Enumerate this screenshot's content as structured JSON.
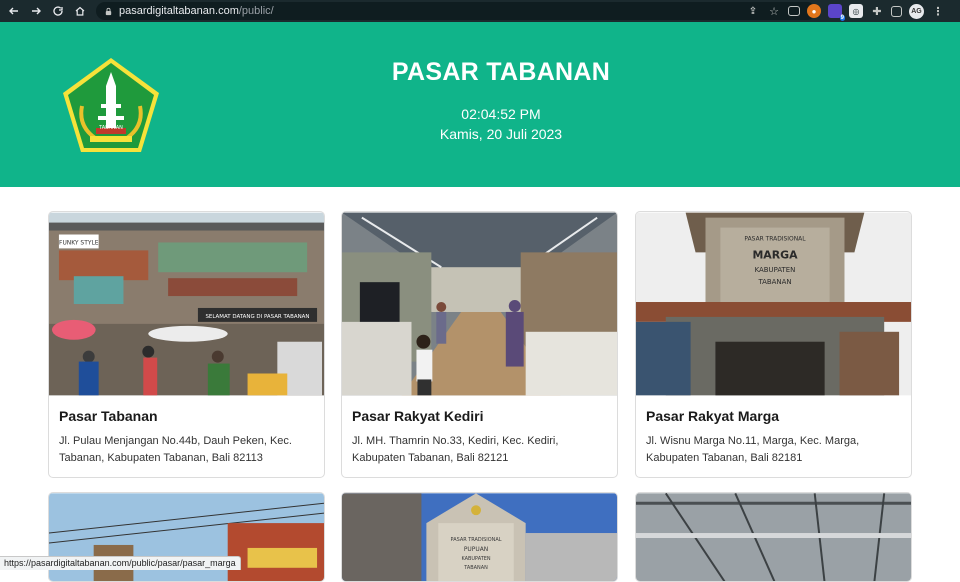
{
  "browser": {
    "url_host": "pasardigitaltabanan.com",
    "url_path": "/public/",
    "extension_badge": "9",
    "profile_initials": "AG"
  },
  "header": {
    "title": "PASAR TABANAN",
    "time": "02:04:52 PM",
    "date": "Kamis, 20 Juli 2023",
    "logo_caption": "TABANAN"
  },
  "markets": [
    {
      "name": "Pasar Tabanan",
      "address": "Jl. Pulau Menjangan No.44b, Dauh Peken, Kec. Tabanan, Kabupaten Tabanan, Bali 82113",
      "photo_sign": "SELAMAT DATANG DI PASAR TABANAN",
      "photo_sign2": "FUNKY STYLE"
    },
    {
      "name": "Pasar Rakyat Kediri",
      "address": "Jl. MH. Thamrin No.33, Kediri, Kec. Kediri, Kabupaten Tabanan, Bali 82121"
    },
    {
      "name": "Pasar Rakyat Marga",
      "address": "Jl. Wisnu Marga No.11, Marga, Kec. Marga, Kabupaten Tabanan, Bali 82181",
      "photo_sign": [
        "PASAR TRADISIONAL",
        "MARGA",
        "KABUPATEN",
        "TABANAN"
      ]
    },
    {
      "name": "",
      "address": ""
    },
    {
      "name": "",
      "address": "",
      "photo_sign": [
        "PASAR TRADISIONAL",
        "PUPUAN",
        "KABUPATEN",
        "TABANAN"
      ]
    },
    {
      "name": "",
      "address": ""
    }
  ],
  "status_bar": "https://pasardigitaltabanan.com/public/pasar/pasar_marga",
  "colors": {
    "header_bg": "#10b48a",
    "chrome_bg": "#1b2a2e",
    "logo_green": "#1f9a3c",
    "logo_yellow": "#f6e23a"
  }
}
